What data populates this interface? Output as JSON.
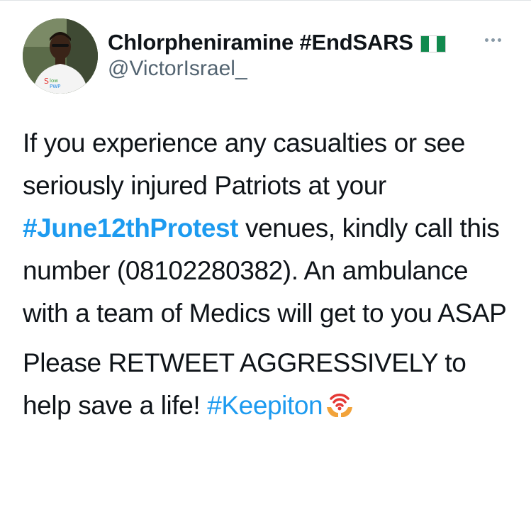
{
  "tweet": {
    "author": {
      "display_name": "Chlorpheniramine #EndSARS",
      "handle": "@VictorIsrael_",
      "flag_icon": "nigeria-flag-icon",
      "avatar_icon": "profile-photo",
      "flag_colors": [
        "#118a4e",
        "#ffffff",
        "#118a4e"
      ]
    },
    "more_icon": "more-horizontal-icon",
    "body": {
      "p1_before": "If you experience any casualties or see seriously injured Patriots at your ",
      "p1_hashtag": "#June12thProtest",
      "p1_after": " venues, kindly call this number (08102280382). An ambulance with a team of Medics will get to you ASAP",
      "p2_before": "Please RETWEET AGGRESSIVELY to help save a life! ",
      "p2_hashtag": "#Keepiton",
      "p2_emoji": "hands-with-signal-emoji"
    },
    "colors": {
      "link": "#1d9bf0",
      "text": "#0f1419",
      "secondary": "#536471"
    }
  }
}
